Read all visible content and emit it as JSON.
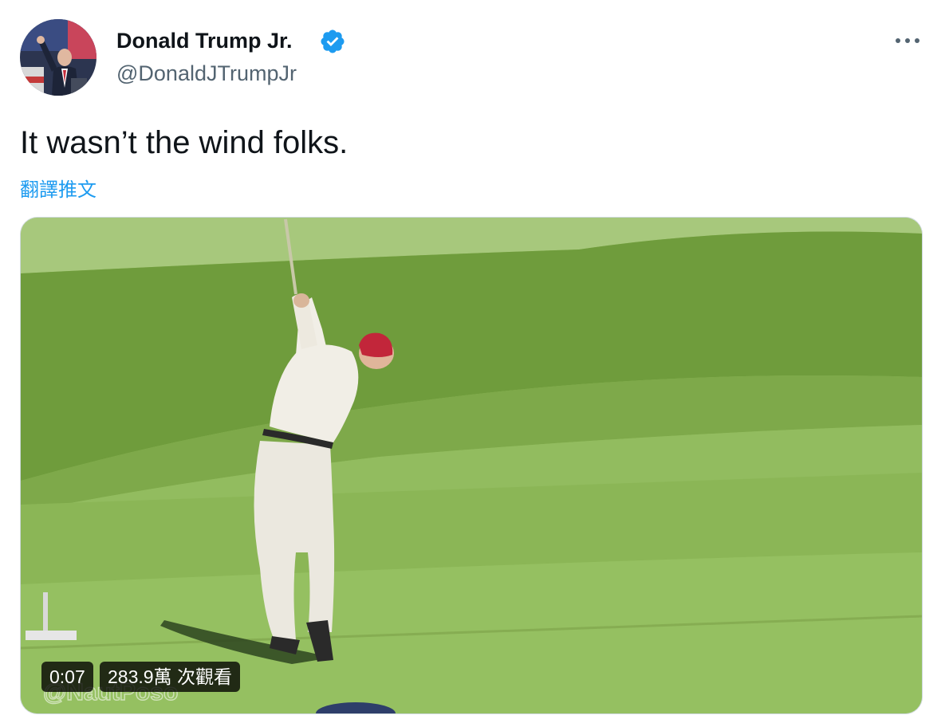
{
  "author": {
    "display_name": "Donald Trump Jr.",
    "handle": "@DonaldJTrumpJr",
    "verified": true,
    "verified_color": "#1d9bf0"
  },
  "tweet": {
    "text": "It wasn’t the wind folks.",
    "translate_label": "翻譯推文"
  },
  "menu": {
    "icon": "more-horizontal-icon"
  },
  "video": {
    "elapsed": "0:07",
    "views": "283.9萬 次觀看",
    "watermark": "@NautPoso"
  },
  "colors": {
    "link": "#1d9bf0",
    "secondary_text": "#536471",
    "border": "#cfd9de"
  }
}
